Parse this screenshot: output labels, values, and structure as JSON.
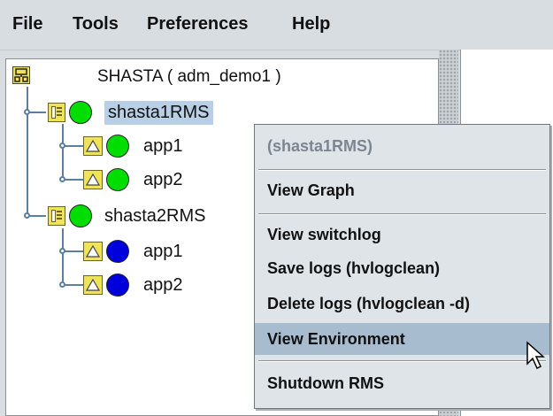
{
  "menubar": {
    "items": [
      "File",
      "Tools",
      "Preferences",
      "Help"
    ]
  },
  "tree": {
    "root": {
      "label": "SHASTA ( adm_demo1 )"
    },
    "nodes": [
      {
        "label": "shasta1RMS",
        "status_color": "#00dd00",
        "selected": true,
        "apps": [
          {
            "label": "app1",
            "status_color": "#00dd00"
          },
          {
            "label": "app2",
            "status_color": "#00dd00"
          }
        ]
      },
      {
        "label": "shasta2RMS",
        "status_color": "#00dd00",
        "selected": false,
        "apps": [
          {
            "label": "app1",
            "status_color": "#0000dd"
          },
          {
            "label": "app2",
            "status_color": "#0000dd"
          }
        ]
      }
    ]
  },
  "context_menu": {
    "header": "(shasta1RMS)",
    "items": [
      {
        "label": "View Graph"
      },
      {
        "label": "View switchlog"
      },
      {
        "label": "Save logs (hvlogclean)"
      },
      {
        "label": "Delete logs (hvlogclean -d)"
      },
      {
        "label": "View Environment",
        "hovered": true
      },
      {
        "label": "Shutdown RMS"
      }
    ]
  },
  "icons": {
    "cluster": "cluster-icon",
    "node": "node-icon",
    "app": "app-triangle-icon",
    "status": "status-circle-icon",
    "cursor": "mouse-pointer-icon"
  }
}
